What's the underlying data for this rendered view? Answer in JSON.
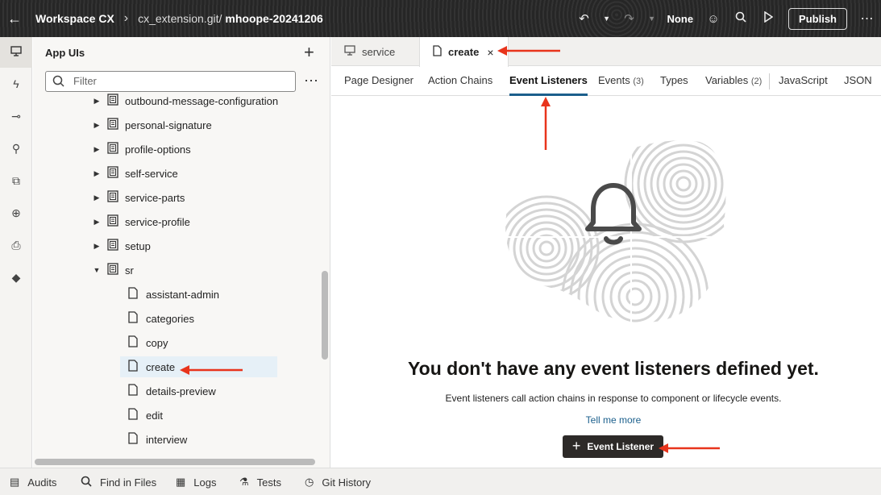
{
  "header": {
    "back_icon": "arrow-left-icon",
    "title": "Workspace CX",
    "separator": "›",
    "repo": "cx_extension.git/",
    "branch": "mhoope-20241206",
    "undo_icon": "undo-icon",
    "redo_icon": "redo-icon",
    "mode_label": "None",
    "publish_label": "Publish"
  },
  "rail": {
    "items": [
      "monitor-icon",
      "lightning-icon",
      "flow-icon",
      "plug-icon",
      "puzzle-icon",
      "globe-icon",
      "document-code-icon",
      "git-icon"
    ]
  },
  "panel": {
    "title": "App UIs",
    "filter_placeholder": "Filter",
    "tree": [
      {
        "label": "outbound-message-configuration",
        "type": "folder",
        "expanded": false
      },
      {
        "label": "personal-signature",
        "type": "folder",
        "expanded": false
      },
      {
        "label": "profile-options",
        "type": "folder",
        "expanded": false
      },
      {
        "label": "self-service",
        "type": "folder",
        "expanded": false
      },
      {
        "label": "service-parts",
        "type": "folder",
        "expanded": false
      },
      {
        "label": "service-profile",
        "type": "folder",
        "expanded": false
      },
      {
        "label": "setup",
        "type": "folder",
        "expanded": false
      },
      {
        "label": "sr",
        "type": "folder",
        "expanded": true
      },
      {
        "label": "assistant-admin",
        "type": "page"
      },
      {
        "label": "categories",
        "type": "page"
      },
      {
        "label": "copy",
        "type": "page"
      },
      {
        "label": "create",
        "type": "page",
        "selected": true
      },
      {
        "label": "details-preview",
        "type": "page"
      },
      {
        "label": "edit",
        "type": "page"
      },
      {
        "label": "interview",
        "type": "page"
      }
    ]
  },
  "editor": {
    "file_tabs": [
      {
        "label": "service",
        "icon": "monitor-icon",
        "active": false
      },
      {
        "label": "create",
        "icon": "page-icon",
        "active": true,
        "close": "×"
      }
    ],
    "sub_tabs": [
      {
        "label": "Page Designer",
        "count": ""
      },
      {
        "label": "Action Chains",
        "count": ""
      },
      {
        "label": "Event Listeners",
        "count": "",
        "active": true
      },
      {
        "label": "Events",
        "count": "(3)"
      },
      {
        "label": "Types",
        "count": ""
      },
      {
        "label": "Variables",
        "count": "(2)"
      },
      {
        "label": "JavaScript",
        "count": ""
      },
      {
        "label": "JSON",
        "count": ""
      }
    ],
    "empty_title": "You don't have any event listeners defined yet.",
    "empty_desc": "Event listeners call action chains in response to component or lifecycle events.",
    "tell_more": "Tell me more",
    "add_button": "Event Listener"
  },
  "bottom": {
    "items": [
      {
        "label": "Audits",
        "icon": "audit-icon"
      },
      {
        "label": "Find in Files",
        "icon": "search-icon"
      },
      {
        "label": "Logs",
        "icon": "logs-icon"
      },
      {
        "label": "Tests",
        "icon": "flask-icon"
      },
      {
        "label": "Git History",
        "icon": "history-icon"
      }
    ]
  },
  "colors": {
    "accent": "#1b5f8c",
    "annotation_arrow": "#e8341c",
    "header_bg": "#2b2b2b",
    "button_dark": "#2d2a28"
  }
}
